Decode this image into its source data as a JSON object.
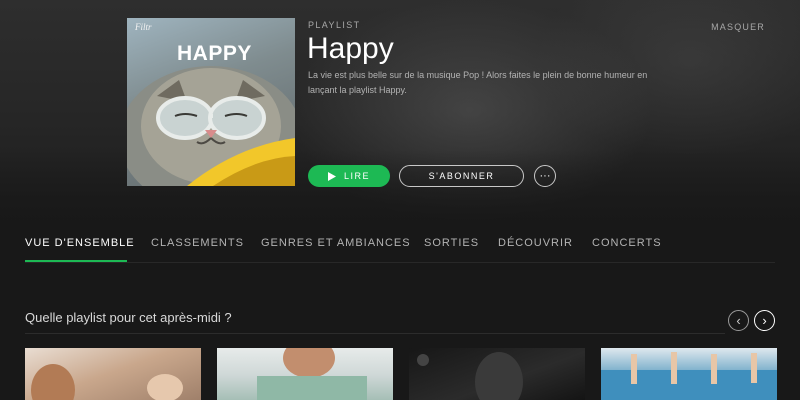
{
  "header": {
    "eyebrow": "PLAYLIST",
    "title": "Happy",
    "description": "La vie est plus belle sur de la musique Pop ! Alors faites le plein de bonne humeur en lançant la playlist Happy.",
    "hide_label": "MASQUER",
    "cover": {
      "brand": "Filtr",
      "title": "HAPPY"
    },
    "buttons": {
      "play": "LIRE",
      "follow": "S'ABONNER",
      "more": "···"
    }
  },
  "tabs": [
    {
      "label": "VUE D'ENSEMBLE",
      "active": true
    },
    {
      "label": "CLASSEMENTS",
      "active": false
    },
    {
      "label": "GENRES ET AMBIANCES",
      "active": false
    },
    {
      "label": "SORTIES",
      "active": false
    },
    {
      "label": "DÉCOUVRIR",
      "active": false
    },
    {
      "label": "CONCERTS",
      "active": false
    }
  ],
  "section": {
    "title": "Quelle playlist pour cet après-midi ?",
    "prev_icon": "chevron-left-icon",
    "next_icon": "chevron-right-icon"
  },
  "colors": {
    "accent": "#1db954",
    "background": "#181818"
  }
}
